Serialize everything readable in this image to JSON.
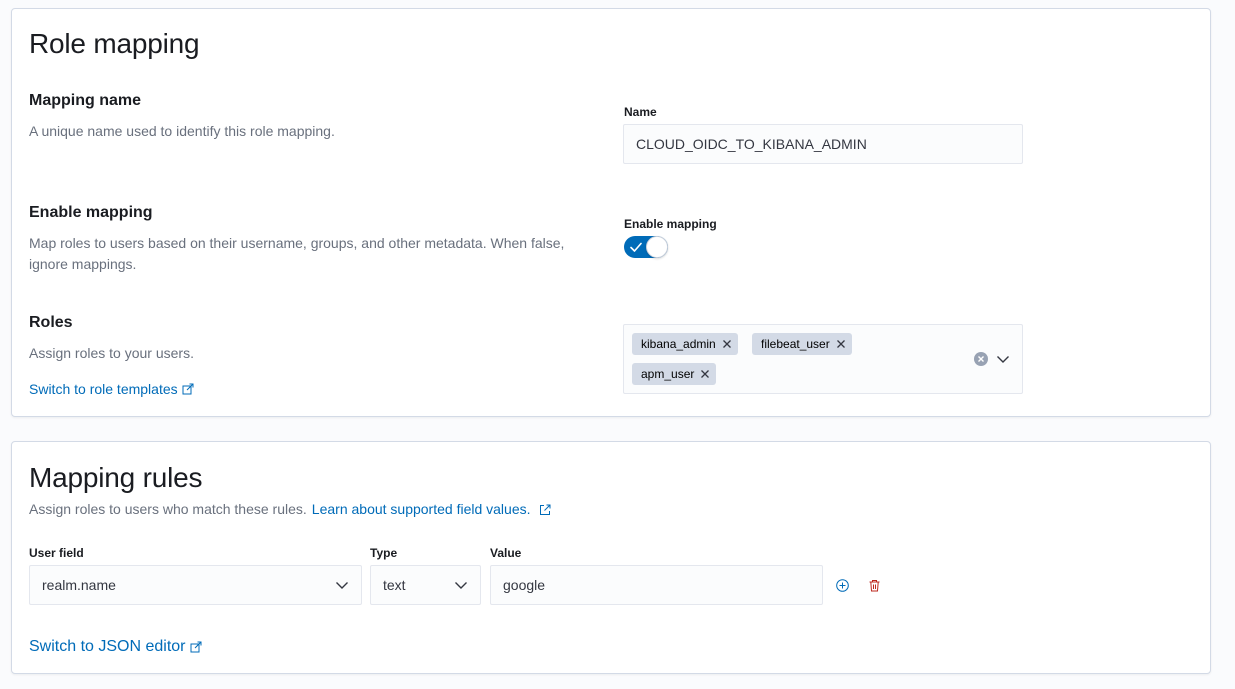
{
  "role_mapping": {
    "title": "Role mapping",
    "mapping_name": {
      "title": "Mapping name",
      "description": "A unique name used to identify this role mapping.",
      "field_label": "Name",
      "value": "CLOUD_OIDC_TO_KIBANA_ADMIN"
    },
    "enable_mapping": {
      "title": "Enable mapping",
      "description_line1": "Map roles to users based on their username, groups, and other metadata. When false,",
      "description_line2": "ignore mappings.",
      "field_label": "Enable mapping",
      "enabled": true
    },
    "roles": {
      "title": "Roles",
      "description": "Assign roles to your users.",
      "switch_link": "Switch to role templates",
      "selected": [
        "kibana_admin",
        "filebeat_user",
        "apm_user"
      ]
    }
  },
  "mapping_rules": {
    "title": "Mapping rules",
    "description": "Assign roles to users who match these rules.",
    "learn_link": "Learn about supported field values.",
    "columns": {
      "user_field": "User field",
      "type": "Type",
      "value": "Value"
    },
    "rule": {
      "user_field": "realm.name",
      "type": "text",
      "value": "google"
    },
    "switch_link": "Switch to JSON editor"
  },
  "colors": {
    "accent": "#006bb8",
    "danger": "#bd271e",
    "pill": "#d3dae6"
  }
}
